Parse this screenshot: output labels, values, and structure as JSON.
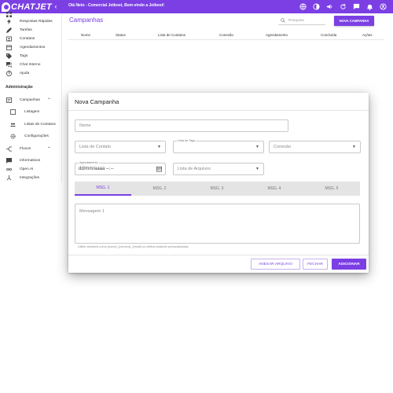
{
  "header": {
    "logo_text": "CHATJET",
    "collapse_icon": "chevron-left-icon",
    "greeting": "Olá Neto - Comercial Jetbost, Bem-vindo a Jetbost!",
    "icons": [
      "globe-icon",
      "contrast-icon",
      "volume-icon",
      "refresh-icon",
      "chat-icon",
      "bell-icon",
      "account-icon"
    ],
    "accent": "#7b3fe4"
  },
  "sidebar": {
    "items": [
      {
        "label": "",
        "icon": "grid-icon"
      },
      {
        "label": "Respostas Rápidas",
        "icon": "bolt-icon"
      },
      {
        "label": "Tarefas",
        "icon": "pencil-icon"
      },
      {
        "label": "Contatos",
        "icon": "contacts-icon"
      },
      {
        "label": "Agendamentos",
        "icon": "calendar-icon"
      },
      {
        "label": "Tags",
        "icon": "tag-icon"
      },
      {
        "label": "Chat Interno",
        "icon": "forum-icon"
      },
      {
        "label": "Ajuda",
        "icon": "help-icon"
      }
    ],
    "admin_title": "Administração",
    "campaigns": {
      "label": "Campanhas",
      "icon": "campaign-icon",
      "chevron": "⌃",
      "children": [
        {
          "label": "Listagem",
          "icon": "list-icon"
        },
        {
          "label": "Listas de Contatos",
          "icon": "people-icon"
        },
        {
          "label": "Configurações",
          "icon": "gear-icon"
        }
      ]
    },
    "flows": {
      "label": "Fluxos",
      "icon": "flow-icon",
      "chevron": "⌃"
    },
    "more": [
      {
        "label": "Informativos",
        "icon": "announcement-icon"
      },
      {
        "label": "Open.Ai",
        "icon": "infinity-icon"
      },
      {
        "label": "Integrações",
        "icon": "integration-icon"
      }
    ]
  },
  "main": {
    "title": "Campanhas",
    "search_placeholder": "Pesquisa",
    "new_button": "NOVA CAMPANHA",
    "columns": [
      "Nome",
      "Status",
      "Lista de Contatos",
      "Conexão",
      "Agendamento",
      "Concluída",
      "Ações"
    ]
  },
  "modal": {
    "title": "Nova Campanha",
    "name_placeholder": "Nome",
    "contact_list_placeholder": "Lista de Contato",
    "tag_list_label": "Lista de Tags",
    "connection_placeholder": "Conexão",
    "schedule_label": "Agendamento",
    "schedule_value": "dd/mm/aaaa --:--",
    "file_list_placeholder": "Lista de Arquivos",
    "tabs": [
      "MSG. 1",
      "MSG. 2",
      "MSG. 3",
      "MSG. 4",
      "MSG. 5"
    ],
    "active_tab": 0,
    "message_placeholder": "Mensagem 1",
    "hint": "Utilize variáveis como {nome}, {numero}, {email} ou defina variáveis personalizadas.",
    "attach_button": "ANEXAR ARQUIVO",
    "close_button": "FECHAR",
    "add_button": "ADICIONAR"
  }
}
